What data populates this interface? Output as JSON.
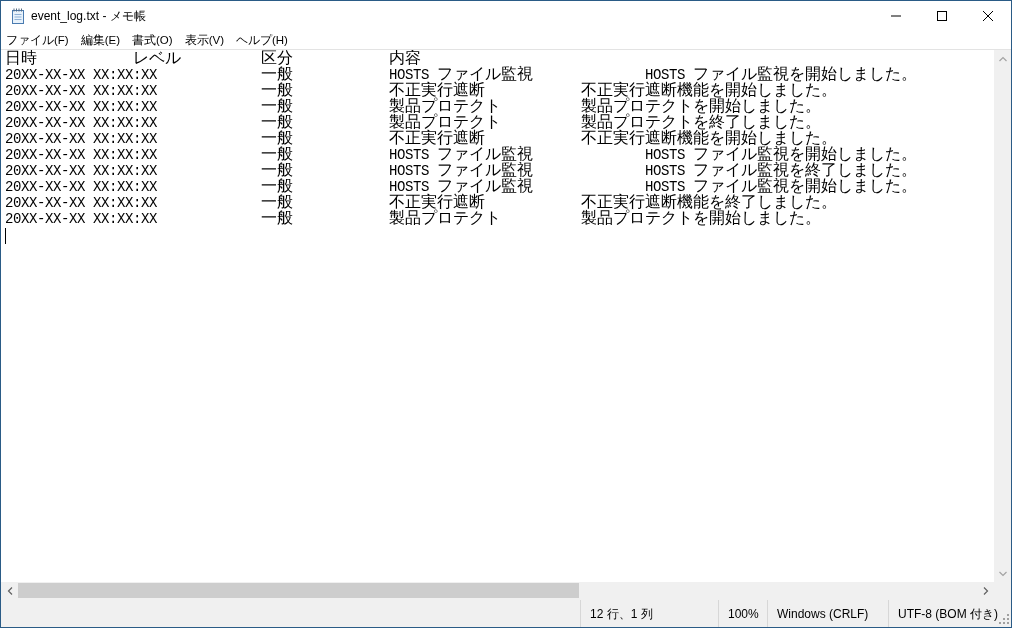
{
  "window": {
    "title": "event_log.txt - メモ帳"
  },
  "menu": [
    "ファイル(F)",
    "編集(E)",
    "書式(O)",
    "表示(V)",
    "ヘルプ(H)"
  ],
  "document": {
    "lines": [
      {
        "fields": [
          "日時",
          "レベル",
          "区分",
          "内容"
        ]
      },
      {
        "fields": [
          "20XX-XX-XX XX:XX:XX",
          "一般",
          "HOSTS ファイル監視",
          "HOSTS ファイル監視を開始しました。"
        ]
      },
      {
        "fields": [
          "20XX-XX-XX XX:XX:XX",
          "一般",
          "不正実行遮断",
          "不正実行遮断機能を開始しました。"
        ]
      },
      {
        "fields": [
          "20XX-XX-XX XX:XX:XX",
          "一般",
          "製品プロテクト",
          "製品プロテクトを開始しました。"
        ]
      },
      {
        "fields": [
          "20XX-XX-XX XX:XX:XX",
          "一般",
          "製品プロテクト",
          "製品プロテクトを終了しました。"
        ]
      },
      {
        "fields": [
          "20XX-XX-XX XX:XX:XX",
          "一般",
          "不正実行遮断",
          "不正実行遮断機能を開始しました。"
        ]
      },
      {
        "fields": [
          "20XX-XX-XX XX:XX:XX",
          "一般",
          "HOSTS ファイル監視",
          "HOSTS ファイル監視を開始しました。"
        ]
      },
      {
        "fields": [
          "20XX-XX-XX XX:XX:XX",
          "一般",
          "HOSTS ファイル監視",
          "HOSTS ファイル監視を終了しました。"
        ]
      },
      {
        "fields": [
          "20XX-XX-XX XX:XX:XX",
          "一般",
          "HOSTS ファイル監視",
          "HOSTS ファイル監視を開始しました。"
        ]
      },
      {
        "fields": [
          "20XX-XX-XX XX:XX:XX",
          "一般",
          "不正実行遮断",
          "不正実行遮断機能を終了しました。"
        ]
      },
      {
        "fields": [
          "20XX-XX-XX XX:XX:XX",
          "一般",
          "製品プロテクト",
          "製品プロテクトを開始しました。"
        ]
      }
    ]
  },
  "status_bar": {
    "position": "12 行、1 列",
    "zoom": "100%",
    "line_ending": "Windows (CRLF)",
    "encoding": "UTF-8 (BOM 付き)"
  }
}
